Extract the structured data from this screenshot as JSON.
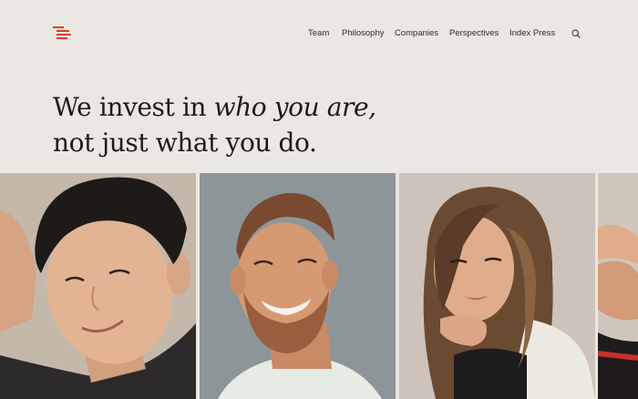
{
  "brand": {
    "accent": "#d9412b",
    "background": "#ebe7e2"
  },
  "nav": {
    "items": [
      {
        "label": "Team"
      },
      {
        "label": "Philosophy"
      },
      {
        "label": "Companies"
      },
      {
        "label": "Perspectives"
      },
      {
        "label": "Index Press"
      }
    ],
    "search_icon": "search-icon"
  },
  "hero": {
    "line1_plain": "We invest in ",
    "line1_italic": "who you are,",
    "line2": "not just what you do."
  },
  "gallery": {
    "portraits": [
      {
        "icon": "portrait-photo",
        "background": "#c9bcb0"
      },
      {
        "icon": "portrait-photo",
        "background": "#8c9698"
      },
      {
        "icon": "portrait-photo",
        "background": "#cdc3ba"
      },
      {
        "icon": "portrait-photo",
        "background": "#d0c6bc"
      }
    ]
  }
}
